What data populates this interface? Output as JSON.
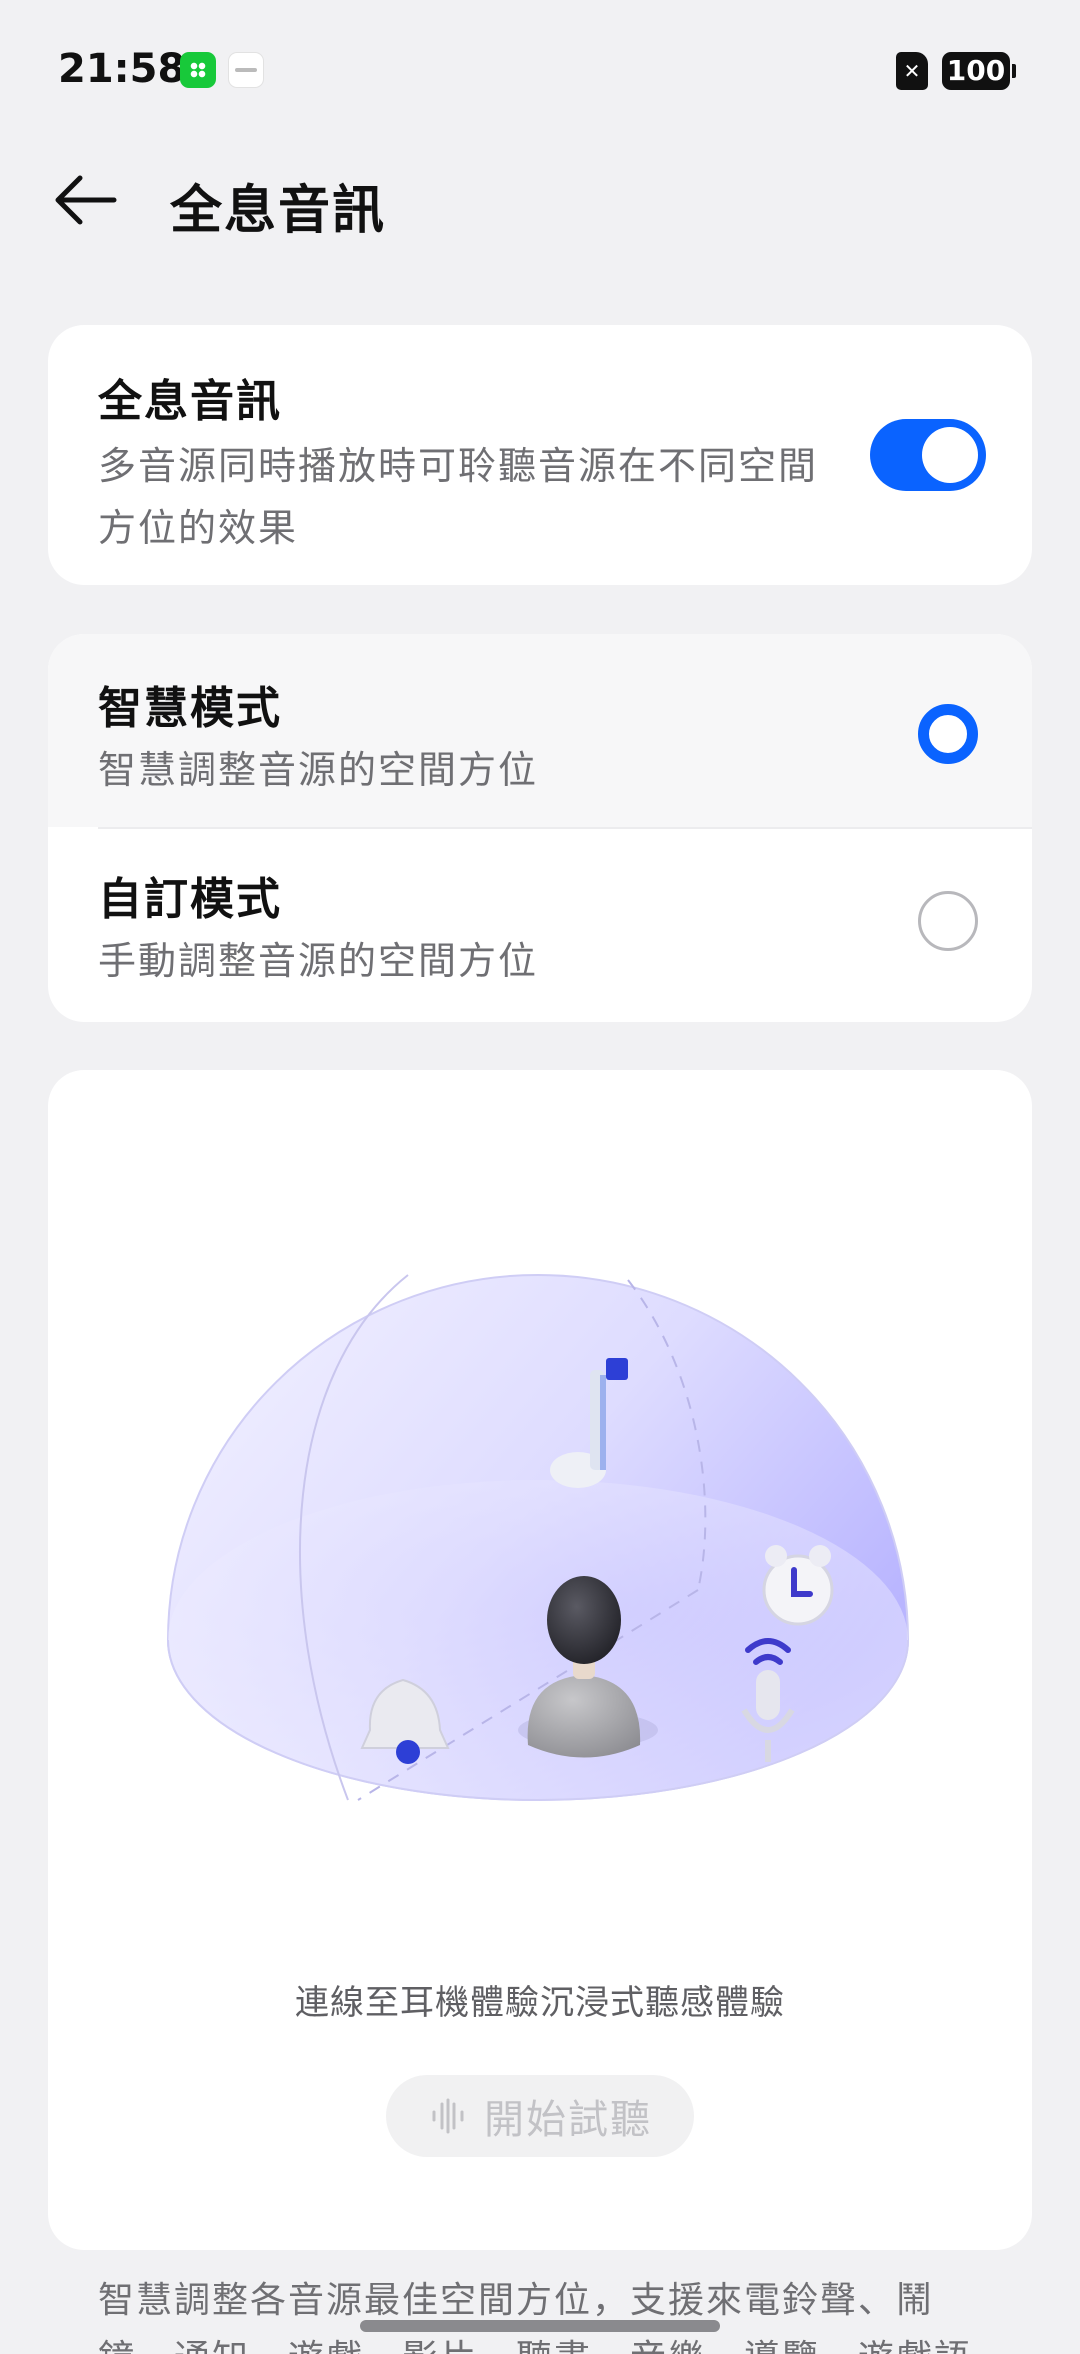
{
  "status_bar": {
    "time": "21:58",
    "sim_icon": "sim-x-icon",
    "battery": "100"
  },
  "header": {
    "back_icon": "arrow-left-icon",
    "title": "全息音訊"
  },
  "toggle_card": {
    "title": "全息音訊",
    "description": "多音源同時播放時可聆聽音源在不同空間方位的效果",
    "enabled": true,
    "accent": "#0a63ff"
  },
  "modes": [
    {
      "title": "智慧模式",
      "subtitle": "智慧調整音源的空間方位",
      "selected": true
    },
    {
      "title": "自訂模式",
      "subtitle": "手動調整音源的空間方位",
      "selected": false
    }
  ],
  "illustration": {
    "icons": [
      "music-note-icon",
      "alarm-clock-icon",
      "bell-icon",
      "microphone-icon",
      "listener-avatar-icon"
    ],
    "hint": "連線至耳機體驗沉浸式聽感體驗",
    "button_label": "開始試聽",
    "button_icon": "sound-wave-icon"
  },
  "footer": {
    "text": "智慧調整各音源最佳空間方位，支援來電鈴聲、鬧鐘、通知、遊戲、影片、聽書、音樂、導覽、遊戲語音"
  }
}
